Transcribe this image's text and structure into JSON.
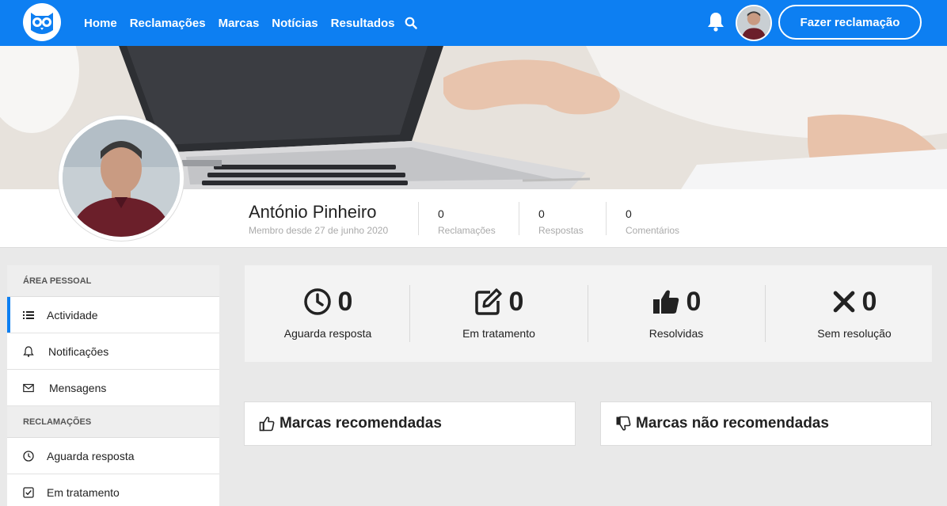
{
  "nav": {
    "links": [
      "Home",
      "Reclamações",
      "Marcas",
      "Notícias",
      "Resultados"
    ],
    "cta_label": "Fazer reclamação",
    "brand_color": "#0d7ff2"
  },
  "profile": {
    "name": "António Pinheiro",
    "member_since": "Membro desde 27 de junho 2020",
    "stats": [
      {
        "value": "0",
        "label": "Reclamações"
      },
      {
        "value": "0",
        "label": "Respostas"
      },
      {
        "value": "0",
        "label": "Comentários"
      }
    ]
  },
  "sidebar": {
    "section_personal": "ÁREA PESSOAL",
    "personal_items": [
      {
        "label": "Actividade",
        "icon": "list-icon"
      },
      {
        "label": "Notificações",
        "icon": "bell-icon"
      },
      {
        "label": "Mensagens",
        "icon": "envelope-icon"
      }
    ],
    "section_complaints": "RECLAMAÇÕES",
    "complaint_items": [
      {
        "label": "Aguarda resposta",
        "icon": "clock-icon"
      },
      {
        "label": "Em tratamento",
        "icon": "checkbox-icon"
      }
    ]
  },
  "summary": [
    {
      "value": "0",
      "label": "Aguarda resposta",
      "icon": "clock-icon"
    },
    {
      "value": "0",
      "label": "Em tratamento",
      "icon": "edit-icon"
    },
    {
      "value": "0",
      "label": "Resolvidas",
      "icon": "thumbs-up-icon"
    },
    {
      "value": "0",
      "label": "Sem resolução",
      "icon": "x-icon"
    }
  ],
  "cards": {
    "recommended": "Marcas recomendadas",
    "not_recommended": "Marcas não recomendadas"
  }
}
